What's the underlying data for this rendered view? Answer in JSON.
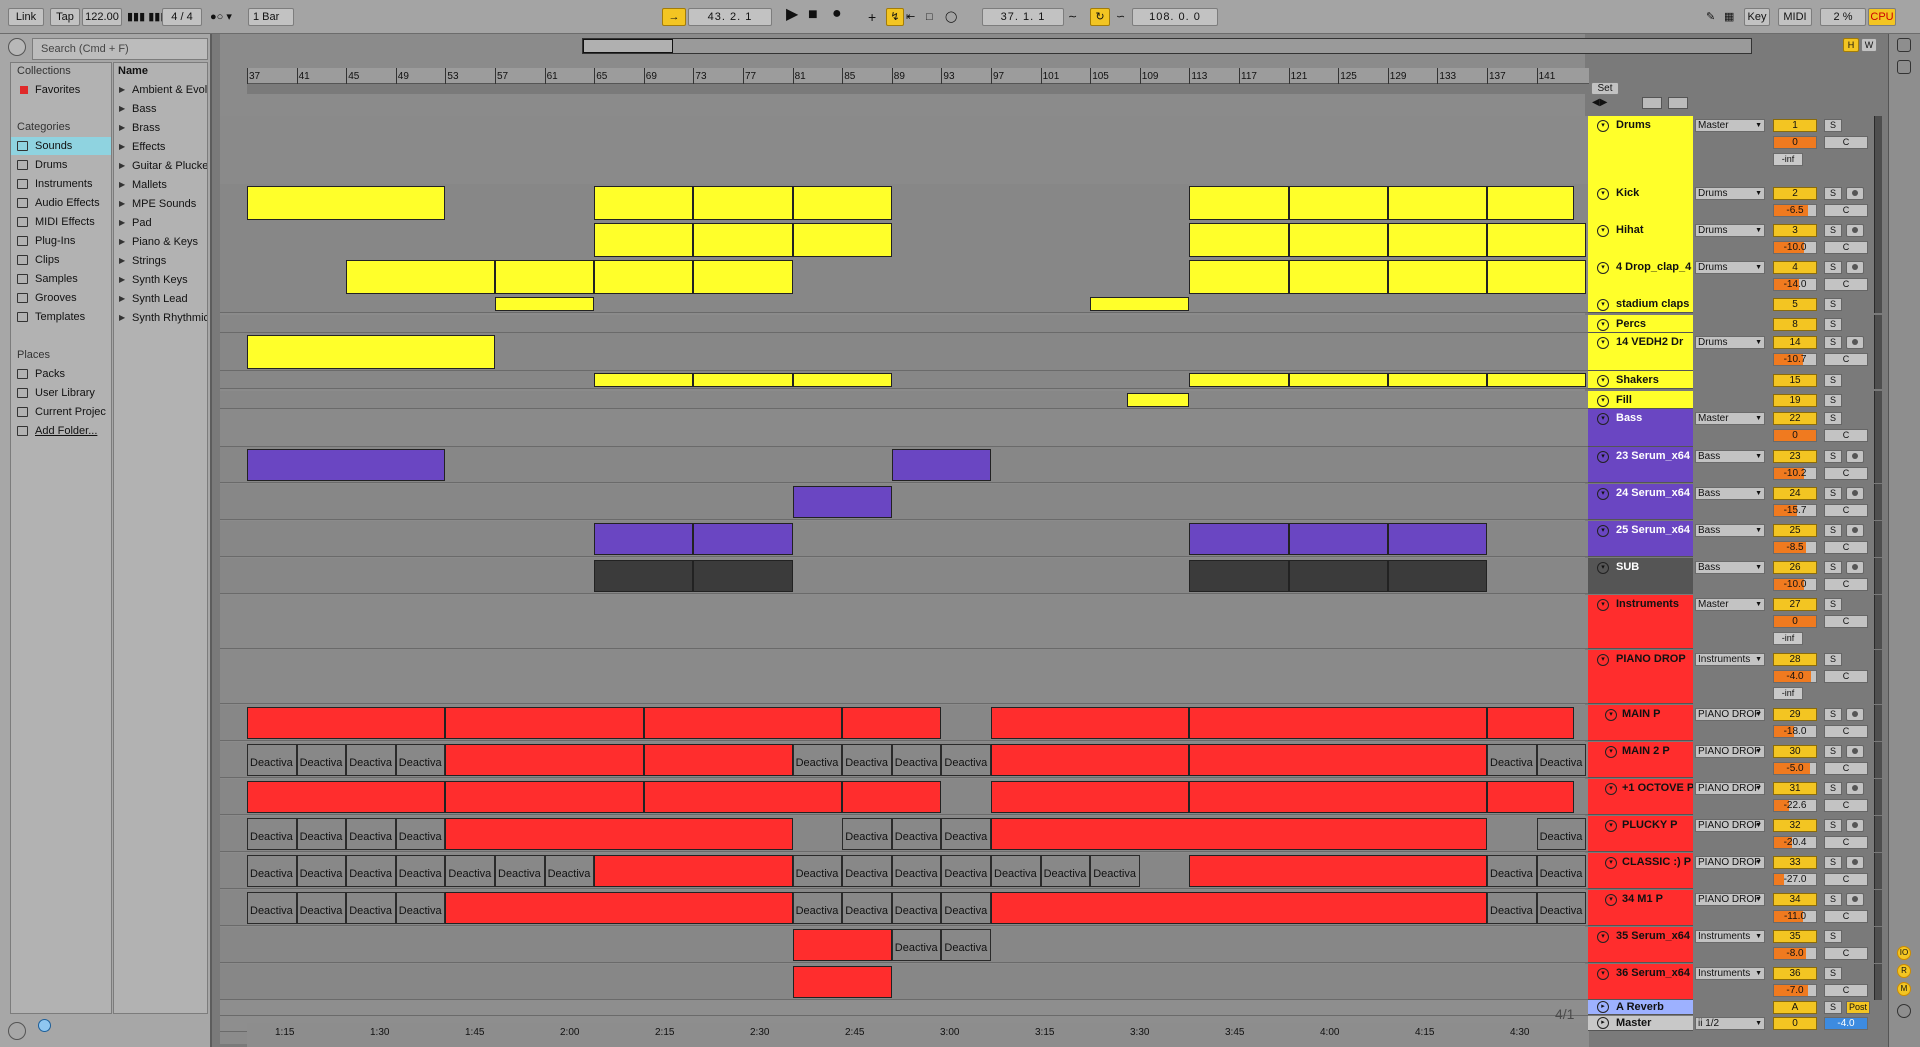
{
  "topbar": {
    "link": "Link",
    "tap": "Tap",
    "tempo": "122.00",
    "signature": "4 / 4",
    "quantize": "1 Bar",
    "position": "43.  2.  1",
    "loop_start": "37.  1.  1",
    "loop_length": "108.  0.  0",
    "key": "Key",
    "midi": "MIDI",
    "cpu_value": "2 %",
    "cpu": "CPU",
    "h": "H",
    "w": "W",
    "set": "Set"
  },
  "browser": {
    "search_placeholder": "Search (Cmd + F)",
    "collections_title": "Collections",
    "favorites": "Favorites",
    "categories_title": "Categories",
    "categories": [
      "Sounds",
      "Drums",
      "Instruments",
      "Audio Effects",
      "MIDI Effects",
      "Plug-Ins",
      "Clips",
      "Samples",
      "Grooves",
      "Templates"
    ],
    "places_title": "Places",
    "places": [
      "Packs",
      "User Library",
      "Current Projec",
      "Add Folder..."
    ],
    "list_header": "Name",
    "list_items": [
      "Ambient & Evolv",
      "Bass",
      "Brass",
      "Effects",
      "Guitar & Plucke",
      "Mallets",
      "MPE Sounds",
      "Pad",
      "Piano & Keys",
      "Strings",
      "Synth Keys",
      "Synth Lead",
      "Synth Rhythmic"
    ]
  },
  "ruler": {
    "bars": [
      "37",
      "41",
      "45",
      "49",
      "53",
      "57",
      "61",
      "65",
      "69",
      "73",
      "77",
      "81",
      "85",
      "89",
      "93",
      "97",
      "101",
      "105",
      "109",
      "113",
      "117",
      "121",
      "125",
      "129",
      "133",
      "137",
      "141"
    ],
    "times": [
      "1:15",
      "1:30",
      "1:45",
      "2:00",
      "2:15",
      "2:30",
      "2:45",
      "3:00",
      "3:15",
      "3:30",
      "3:45",
      "4:00",
      "4:15",
      "4:30"
    ]
  },
  "clip_label": "Deactiva",
  "clip_label_short": "ac",
  "time_signature_marker": "4/1",
  "tracks": [
    {
      "name": "Drums",
      "io": "Master",
      "num": "1",
      "vol": "0",
      "extra": "-inf",
      "color": "#ffff2a",
      "kind": "group"
    },
    {
      "name": "Kick",
      "io": "Drums",
      "num": "2",
      "vol": "-6.5",
      "color": "#ffff2a"
    },
    {
      "name": "Hihat",
      "io": "Drums",
      "num": "3",
      "vol": "-10.0",
      "color": "#ffff2a"
    },
    {
      "name": "4 Drop_clap_4",
      "io": "Drums",
      "num": "4",
      "vol": "-14.0",
      "color": "#ffff2a"
    },
    {
      "name": "stadium claps",
      "io": "",
      "num": "5",
      "vol": "",
      "color": "#ffff2a"
    },
    {
      "name": "Percs",
      "io": "",
      "num": "8",
      "vol": "",
      "color": "#ffff2a"
    },
    {
      "name": "14 VEDH2 Dr",
      "io": "Drums",
      "num": "14",
      "vol": "-10.7",
      "color": "#ffff2a"
    },
    {
      "name": "Shakers",
      "io": "",
      "num": "15",
      "vol": "",
      "color": "#ffff2a"
    },
    {
      "name": "Fill",
      "io": "",
      "num": "19",
      "vol": "",
      "color": "#ffff2a"
    },
    {
      "name": "Bass",
      "io": "Master",
      "num": "22",
      "vol": "0",
      "color": "#6a46c2",
      "kind": "group"
    },
    {
      "name": "23 Serum_x64",
      "io": "Bass",
      "num": "23",
      "vol": "-10.2",
      "color": "#6a46c2"
    },
    {
      "name": "24 Serum_x64",
      "io": "Bass",
      "num": "24",
      "vol": "-15.7",
      "color": "#6a46c2"
    },
    {
      "name": "25 Serum_x64",
      "io": "Bass",
      "num": "25",
      "vol": "-8.5",
      "color": "#6a46c2"
    },
    {
      "name": "SUB",
      "io": "Bass",
      "num": "26",
      "vol": "-10.0",
      "color": "#555555"
    },
    {
      "name": "Instruments",
      "io": "Master",
      "num": "27",
      "vol": "0",
      "extra": "-inf",
      "color": "#ff2d2d",
      "kind": "group"
    },
    {
      "name": "PIANO DROP",
      "io": "Instruments",
      "num": "28",
      "vol": "-4.0",
      "extra": "-inf",
      "color": "#ff2d2d",
      "kind": "group"
    },
    {
      "name": "MAIN P",
      "io": "PIANO DROP",
      "num": "29",
      "vol": "-18.0",
      "color": "#ff2d2d"
    },
    {
      "name": "MAIN 2 P",
      "io": "PIANO DROP",
      "num": "30",
      "vol": "-5.0",
      "color": "#ff2d2d"
    },
    {
      "name": "+1 OCTOVE P",
      "io": "PIANO DROP",
      "num": "31",
      "vol": "-22.6",
      "color": "#ff2d2d"
    },
    {
      "name": "PLUCKY P",
      "io": "PIANO DROP",
      "num": "32",
      "vol": "-20.4",
      "color": "#ff2d2d"
    },
    {
      "name": "CLASSIC :) P",
      "io": "PIANO DROP",
      "num": "33",
      "vol": "-27.0",
      "color": "#ff2d2d"
    },
    {
      "name": "34 M1 P",
      "io": "PIANO DROP",
      "num": "34",
      "vol": "-11.0",
      "color": "#ff2d2d"
    },
    {
      "name": "35 Serum_x64",
      "io": "Instruments",
      "num": "35",
      "vol": "-8.0",
      "color": "#ff2d2d"
    },
    {
      "name": "36 Serum_x64",
      "io": "Instruments",
      "num": "36",
      "vol": "-7.0",
      "color": "#ff2d2d"
    }
  ],
  "returns": [
    {
      "name": "A Reverb",
      "num": "A",
      "post": "Post",
      "color": "#9db1ff"
    },
    {
      "name": "Master",
      "io": "ii 1/2",
      "num": "0",
      "vol": "-4.0",
      "color": "#c8c8c8"
    }
  ],
  "pan_center": "C",
  "solo": "S"
}
